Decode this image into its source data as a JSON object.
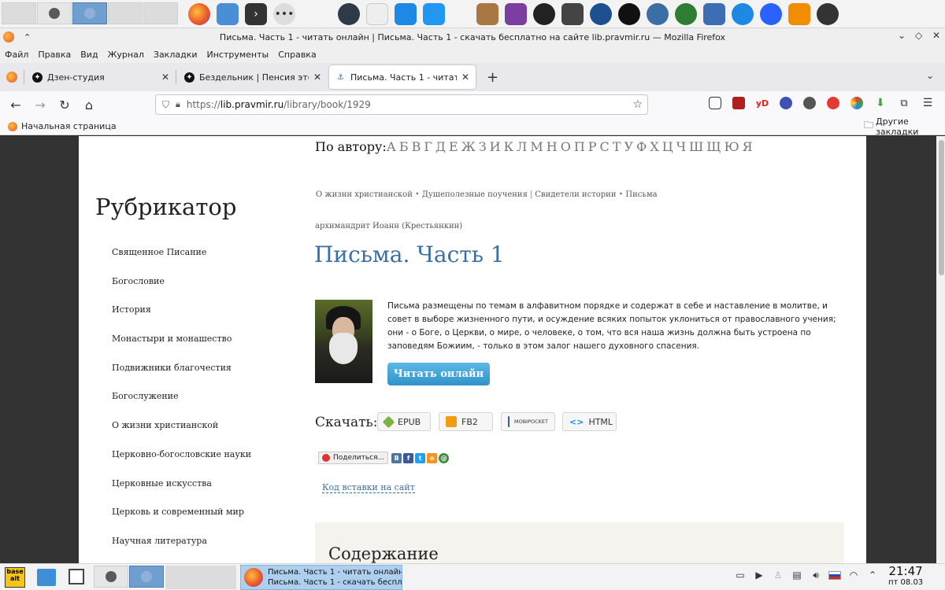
{
  "window": {
    "title": "Письма. Часть 1 - читать онлайн | Письма. Часть 1 - скачать бесплатно на сайте lib.pravmir.ru — Mozilla Firefox"
  },
  "menu": [
    "Файл",
    "Правка",
    "Вид",
    "Журнал",
    "Закладки",
    "Инструменты",
    "Справка"
  ],
  "tabs": [
    {
      "label": "Дзен-студия",
      "active": false
    },
    {
      "label": "Бездельник | Пенсия это кайф",
      "active": false
    },
    {
      "label": "Письма. Часть 1 - читать онлайн",
      "active": true
    }
  ],
  "url": {
    "prefix": "https://",
    "host": "lib.pravmir.ru",
    "path": "/library/book/1929"
  },
  "bookmarks": {
    "home": "Начальная страница",
    "other": "Другие закладки"
  },
  "alphabet": {
    "label": "По автору:",
    "letters": [
      "А",
      "Б",
      "В",
      "Г",
      "Д",
      "Е",
      "Ж",
      "З",
      "И",
      "К",
      "Л",
      "М",
      "Н",
      "О",
      "П",
      "Р",
      "С",
      "Т",
      "У",
      "Ф",
      "Х",
      "Ц",
      "Ч",
      "Ш",
      "Щ",
      "Ю",
      "Я"
    ]
  },
  "rubricator": {
    "title": "Рубрикатор",
    "items": [
      "Священное Писание",
      "Богословие",
      "История",
      "Монастыри и монашество",
      "Подвижники благочестия",
      "Богослужение",
      "О жизни христианской",
      "Церковно-богословские науки",
      "Церковные искусства",
      "Церковь и современный мир",
      "Научная литература"
    ]
  },
  "breadcrumbs": {
    "c1": "О жизни христианской",
    "c2": "Душеполезные поучения",
    "c3": "Свидетели истории",
    "c4": "Письма",
    "dot": "•",
    "bar": "|"
  },
  "book": {
    "author": "архимандрит Иоанн (Крестьянкин)",
    "title": "Письма. Часть 1",
    "description": "Письма размещены по темам в алфавитном порядке и содержат в себе и наставление в молитве, и совет в выборе жизненного пути, и осуждение всяких попыток уклониться от православного учения; они - о Боге, о Церкви, о мире, о человеке, о том, что вся наша жизнь должна быть устроена по заповедям Божиим, - только в этом залог нашего духовного спасения.",
    "read_button": "Читать онлайн"
  },
  "download": {
    "label": "Скачать:",
    "formats": [
      "EPUB",
      "FB2",
      "MOBIPOCKET",
      "HTML"
    ]
  },
  "share": {
    "button": "Поделиться...",
    "embed": "Код вставки на сайт"
  },
  "toc": {
    "title": "Содержание"
  },
  "taskbar": {
    "task_line1": "Письма. Часть 1 - читать онлайн |",
    "task_line2": "Письма. Часть 1 - скачать бесплат...",
    "time": "21:47",
    "date": "пт 08.03"
  },
  "colors": {
    "accent_link": "#3a6fa3",
    "read_button": "#3aa3d8",
    "toc_bg": "#f5f3ee"
  }
}
